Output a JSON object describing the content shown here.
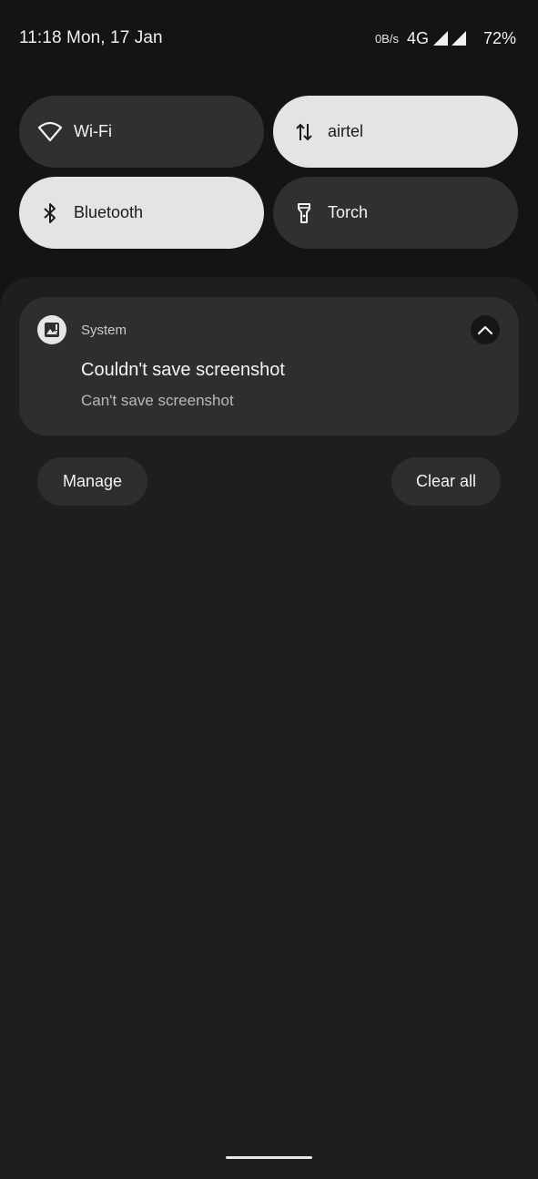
{
  "status_bar": {
    "time": "11:18 Mon, 17 Jan",
    "net_speed": "0B/s",
    "network_type": "4G",
    "battery": "72%",
    "icons": [
      "signal-icon",
      "signal-icon"
    ]
  },
  "quick_settings": {
    "tiles": [
      {
        "label": "Wi-Fi",
        "icon": "wifi-icon",
        "state": "off"
      },
      {
        "label": "airtel",
        "icon": "mobile-data-icon",
        "state": "on"
      },
      {
        "label": "Bluetooth",
        "icon": "bluetooth-icon",
        "state": "on"
      },
      {
        "label": "Torch",
        "icon": "flashlight-icon",
        "state": "off"
      }
    ]
  },
  "notification": {
    "app_name": "System",
    "app_icon": "screenshot-image-icon",
    "title": "Couldn't save screenshot",
    "text": "Can't save screenshot",
    "expand_icon": "chevron-up-icon"
  },
  "actions": {
    "manage_label": "Manage",
    "clear_all_label": "Clear all"
  },
  "colors": {
    "background": "#141414",
    "shade": "#1e1e1e",
    "tile_off": "#303030",
    "tile_on": "#e4e4e4",
    "card": "#2e2e2e"
  }
}
